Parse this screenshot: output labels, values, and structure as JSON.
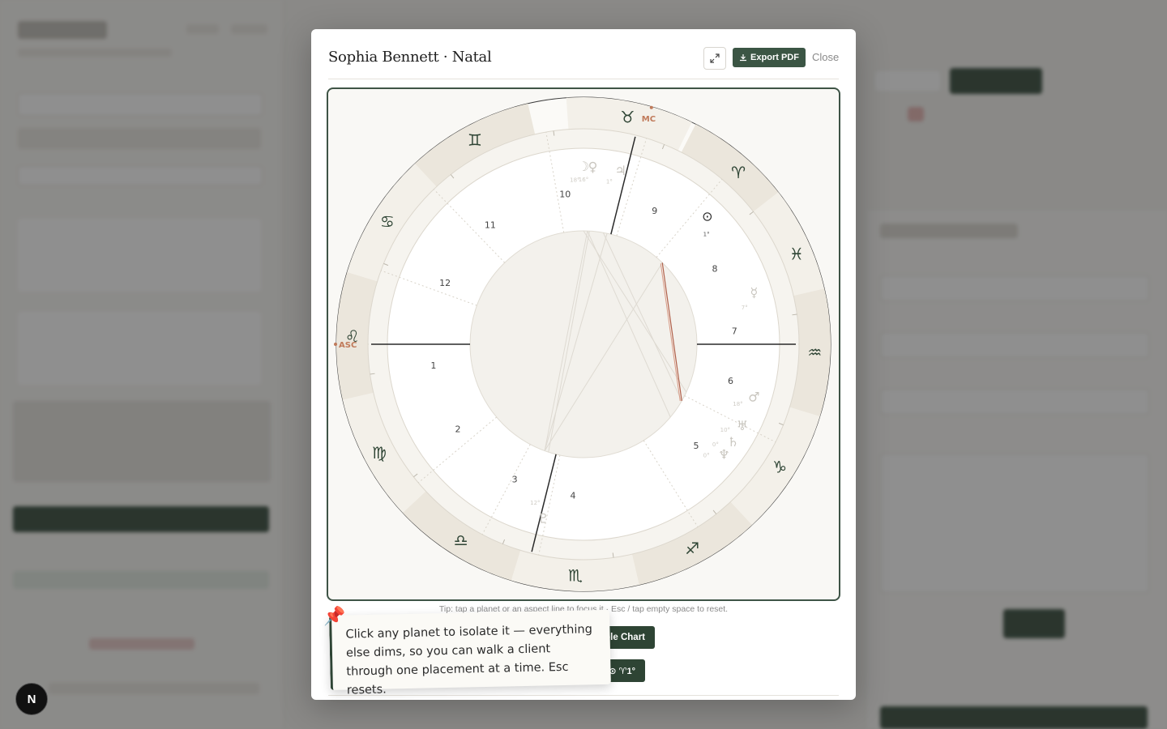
{
  "modal": {
    "title": "Sophia Bennett · Natal",
    "export_label": "Export PDF",
    "close_label": "Close",
    "tip": "Tip: tap a planet or an aspect line to focus it · Esc / tap empty space to reset.",
    "whole_chart_label": "ole Chart",
    "aspect_pill_label": "⊙ ♈1°"
  },
  "note": {
    "text": "Click any planet to isolate it — everything else dims, so you can walk a client through one placement at a time. Esc resets."
  },
  "chart": {
    "signs": [
      "♉",
      "♈",
      "♓",
      "♒",
      "♑",
      "♐",
      "♏",
      "♎",
      "♍",
      "♌",
      "♋",
      "♊"
    ],
    "houses": [
      "10",
      "9",
      "8",
      "7",
      "6",
      "5",
      "4",
      "3",
      "2",
      "1",
      "12",
      "11"
    ],
    "asc_label": "ASC",
    "mc_label": "MC",
    "planets": [
      {
        "glyph": "☽",
        "deg": "18°"
      },
      {
        "glyph": "♀",
        "deg": "16°"
      },
      {
        "glyph": "♃",
        "deg": "1°"
      },
      {
        "glyph": "⊙",
        "deg": "1°"
      },
      {
        "glyph": "☿",
        "deg": "7°"
      },
      {
        "glyph": "♂",
        "deg": "18°"
      },
      {
        "glyph": "♅",
        "deg": "10°"
      },
      {
        "glyph": "♄",
        "deg": "0°"
      },
      {
        "glyph": "♆",
        "deg": "0°"
      },
      {
        "glyph": "♇",
        "deg": "12°"
      }
    ]
  },
  "background": {
    "badge": "N"
  }
}
